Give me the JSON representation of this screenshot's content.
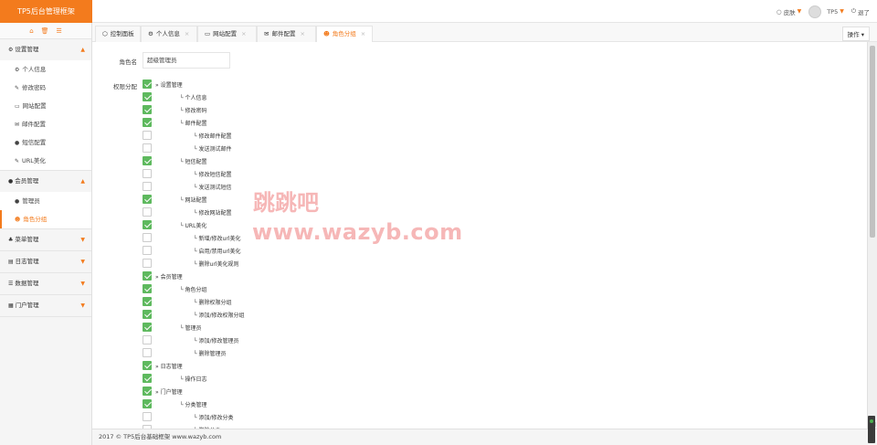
{
  "app": {
    "title": "TP5后台管理框架"
  },
  "top_right": {
    "skin": "皮肤",
    "user": "TP5",
    "logout": "退了"
  },
  "sidebar": {
    "groups": [
      {
        "label": "设置管理",
        "icon": "gears-icon",
        "expanded": true,
        "items": [
          {
            "label": "个人信息",
            "icon": "gear-icon"
          },
          {
            "label": "修改密码",
            "icon": "edit-icon"
          },
          {
            "label": "网站配置",
            "icon": "desktop-icon"
          },
          {
            "label": "邮件配置",
            "icon": "envelope-icon"
          },
          {
            "label": "短信配置",
            "icon": "comment-icon"
          },
          {
            "label": "URL美化",
            "icon": "link-icon"
          }
        ]
      },
      {
        "label": "会员管理",
        "icon": "user-icon",
        "expanded": true,
        "items": [
          {
            "label": "管理员",
            "icon": "user-icon"
          },
          {
            "label": "角色分组",
            "icon": "users-icon",
            "active": true
          }
        ]
      },
      {
        "label": "菜单管理",
        "icon": "sitemap-icon",
        "expanded": false,
        "items": []
      },
      {
        "label": "日志管理",
        "icon": "book-icon",
        "expanded": false,
        "items": []
      },
      {
        "label": "数据管理",
        "icon": "database-icon",
        "expanded": false,
        "items": []
      },
      {
        "label": "门户管理",
        "icon": "th-icon",
        "expanded": false,
        "items": []
      }
    ]
  },
  "tabs": [
    {
      "label": "控制面板",
      "icon": "dashboard-icon",
      "closable": false
    },
    {
      "label": "个人信息",
      "icon": "gear-icon",
      "closable": true
    },
    {
      "label": "网站配置",
      "icon": "desktop-icon",
      "closable": true
    },
    {
      "label": "邮件配置",
      "icon": "envelope-icon",
      "closable": true
    },
    {
      "label": "角色分组",
      "icon": "users-icon",
      "closable": true,
      "active": true
    }
  ],
  "tab_ops_label": "操作",
  "form": {
    "role_name_label": "角色名",
    "role_name_value": "超级管理员",
    "perm_label": "权限分配"
  },
  "permissions": [
    {
      "label": "» 设置管理",
      "checked": true
    },
    {
      "label": "└ 个人信息",
      "checked": true
    },
    {
      "label": "└ 修改密码",
      "checked": true
    },
    {
      "label": "└ 邮件配置",
      "checked": true
    },
    {
      "label": "└ 修改邮件配置",
      "checked": false
    },
    {
      "label": "└ 发送测试邮件",
      "checked": false
    },
    {
      "label": "└ 短信配置",
      "checked": true
    },
    {
      "label": "└ 修改短信配置",
      "checked": false
    },
    {
      "label": "└ 发送测试短信",
      "checked": false
    },
    {
      "label": "└ 网站配置",
      "checked": true
    },
    {
      "label": "└ 修改网站配置",
      "checked": false
    },
    {
      "label": "└ URL美化",
      "checked": true
    },
    {
      "label": "└ 新增/修改url美化",
      "checked": false
    },
    {
      "label": "└ 启用/禁用url美化",
      "checked": false
    },
    {
      "label": "└ 删除url美化规则",
      "checked": false
    },
    {
      "label": "» 会员管理",
      "checked": true
    },
    {
      "label": "└ 角色分组",
      "checked": true
    },
    {
      "label": "└ 删除权限分组",
      "checked": true
    },
    {
      "label": "└ 添加/修改权限分组",
      "checked": true
    },
    {
      "label": "└ 管理员",
      "checked": true
    },
    {
      "label": "└ 添加/修改管理员",
      "checked": false
    },
    {
      "label": "└ 删除管理员",
      "checked": false
    },
    {
      "label": "» 日志管理",
      "checked": true
    },
    {
      "label": "└ 操作日志",
      "checked": true
    },
    {
      "label": "» 门户管理",
      "checked": true
    },
    {
      "label": "└ 分类管理",
      "checked": true
    },
    {
      "label": "└ 添加/修改分类",
      "checked": false
    },
    {
      "label": "└ 删除分类",
      "checked": false
    }
  ],
  "watermark": {
    "line1": "跳跳吧",
    "line2": "www.wazyb.com"
  },
  "footer": "2017 © TP5后台基础框架 www.wazyb.com"
}
